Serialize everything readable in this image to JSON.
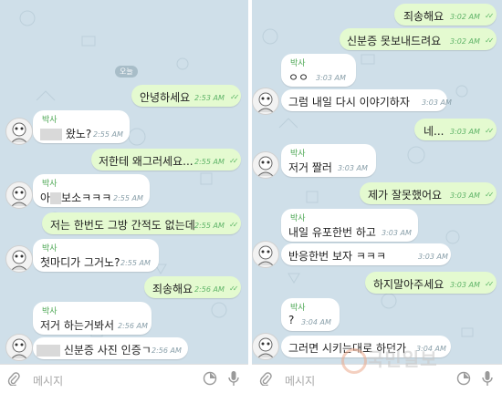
{
  "left": {
    "date_chip": "오늘",
    "messages": [
      {
        "dir": "out",
        "text": "안녕하세요",
        "time": "2:53 AM"
      },
      {
        "dir": "in",
        "name": "박사",
        "text": "왔노?",
        "time": "2:55 AM"
      },
      {
        "dir": "out",
        "text": "저한테 왜그러세요...",
        "time": "2:55 AM"
      },
      {
        "dir": "in",
        "name": "박사",
        "text_pre": "아",
        "text": "보소ㅋㅋㅋ",
        "time": "2:55 AM"
      },
      {
        "dir": "out",
        "text": "저는 한번도 그방 간적도 없는데",
        "time": "2:55 AM"
      },
      {
        "dir": "in",
        "name": "박사",
        "text": "첫마디가 그거노?",
        "time": "2:55 AM"
      },
      {
        "dir": "out",
        "text": "죄송해요",
        "time": "2:56 AM"
      },
      {
        "dir": "in",
        "name": "박사",
        "text": "저거 하는거봐서",
        "time": "2:56 AM"
      },
      {
        "dir": "in",
        "text": "신분증 사진 인증ㄱ",
        "time": "2:56 AM"
      }
    ],
    "input_placeholder": "메시지"
  },
  "right": {
    "messages": [
      {
        "dir": "out",
        "text": "죄송해요",
        "time": "3:02 AM"
      },
      {
        "dir": "out",
        "text": "신분증 못보내드려요",
        "time": "3:02 AM"
      },
      {
        "dir": "in",
        "name": "박사",
        "text": "ㅇㅇ",
        "time": "3:03 AM"
      },
      {
        "dir": "in",
        "text": "그럼 내일 다시 이야기하자",
        "time": "3:03 AM"
      },
      {
        "dir": "out",
        "text": "네...",
        "time": "3:03 AM"
      },
      {
        "dir": "in",
        "name": "박사",
        "text": "저거 짤러",
        "time": "3:03 AM"
      },
      {
        "dir": "out",
        "text": "제가 잘못했어요",
        "time": "3:03 AM"
      },
      {
        "dir": "in",
        "name": "박사",
        "text": "내일 유포한번 하고",
        "time": "3:03 AM"
      },
      {
        "dir": "in",
        "text": "반응한번 보자 ㅋㅋㅋ",
        "time": "3:03 AM"
      },
      {
        "dir": "out",
        "text": "하지말아주세요",
        "time": "3:03 AM"
      },
      {
        "dir": "in",
        "name": "박사",
        "text": "?",
        "time": "3:04 AM"
      },
      {
        "dir": "in",
        "text": "그러면 시키는대로 하던가",
        "time": "3:04 AM"
      }
    ],
    "input_placeholder": "메시지"
  },
  "watermark": "국민일보",
  "colors": {
    "outgoing": "#e4fad0",
    "incoming": "#ffffff",
    "background": "#cfdfe9",
    "check": "#5cb665",
    "name": "#4fa856"
  }
}
